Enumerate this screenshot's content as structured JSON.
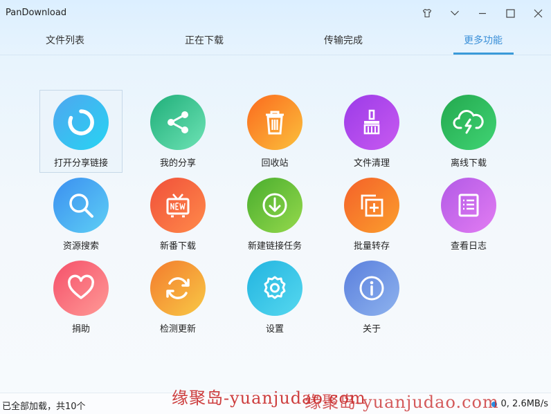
{
  "window": {
    "title": "PanDownload"
  },
  "tabs": [
    "文件列表",
    "正在下载",
    "传输完成",
    "更多功能"
  ],
  "features": [
    {
      "label": "打开分享链接",
      "icon": "open-share-link-icon",
      "colors": [
        "#4fa6f0",
        "#27d4f2"
      ]
    },
    {
      "label": "我的分享",
      "icon": "share-icon",
      "colors": [
        "#1fae79",
        "#6ee3b5"
      ]
    },
    {
      "label": "回收站",
      "icon": "trash-icon",
      "colors": [
        "#fb6a1e",
        "#fbc03c"
      ]
    },
    {
      "label": "文件清理",
      "icon": "brush-icon",
      "colors": [
        "#9b3be8",
        "#c85af0"
      ]
    },
    {
      "label": "离线下载",
      "icon": "cloud-download-icon",
      "colors": [
        "#22a84e",
        "#41d474"
      ]
    },
    {
      "label": "资源搜索",
      "icon": "search-icon",
      "colors": [
        "#3b8ff0",
        "#5ecff5"
      ]
    },
    {
      "label": "新番下载",
      "icon": "new-tv-icon",
      "colors": [
        "#f0503a",
        "#ff8a4a"
      ]
    },
    {
      "label": "新建链接任务",
      "icon": "download-circle-icon",
      "colors": [
        "#49ad2e",
        "#95d94c"
      ]
    },
    {
      "label": "批量转存",
      "icon": "batch-save-icon",
      "colors": [
        "#f4612a",
        "#fb9e2c"
      ]
    },
    {
      "label": "查看日志",
      "icon": "log-icon",
      "colors": [
        "#b25ae6",
        "#e27cf2"
      ]
    },
    {
      "label": "捐助",
      "icon": "heart-icon",
      "colors": [
        "#f5506a",
        "#ff9a96"
      ]
    },
    {
      "label": "检测更新",
      "icon": "refresh-icon",
      "colors": [
        "#f37b2d",
        "#f8c946"
      ]
    },
    {
      "label": "设置",
      "icon": "gear-icon",
      "colors": [
        "#22b4e0",
        "#56d8ef"
      ]
    },
    {
      "label": "关于",
      "icon": "info-icon",
      "colors": [
        "#5a7fdd",
        "#8eb3ee"
      ]
    }
  ],
  "status": {
    "text": "已全部加载，共10个",
    "speed": "0, 2.6MB/s"
  },
  "watermark": "缘聚岛-yuanjudao.com"
}
